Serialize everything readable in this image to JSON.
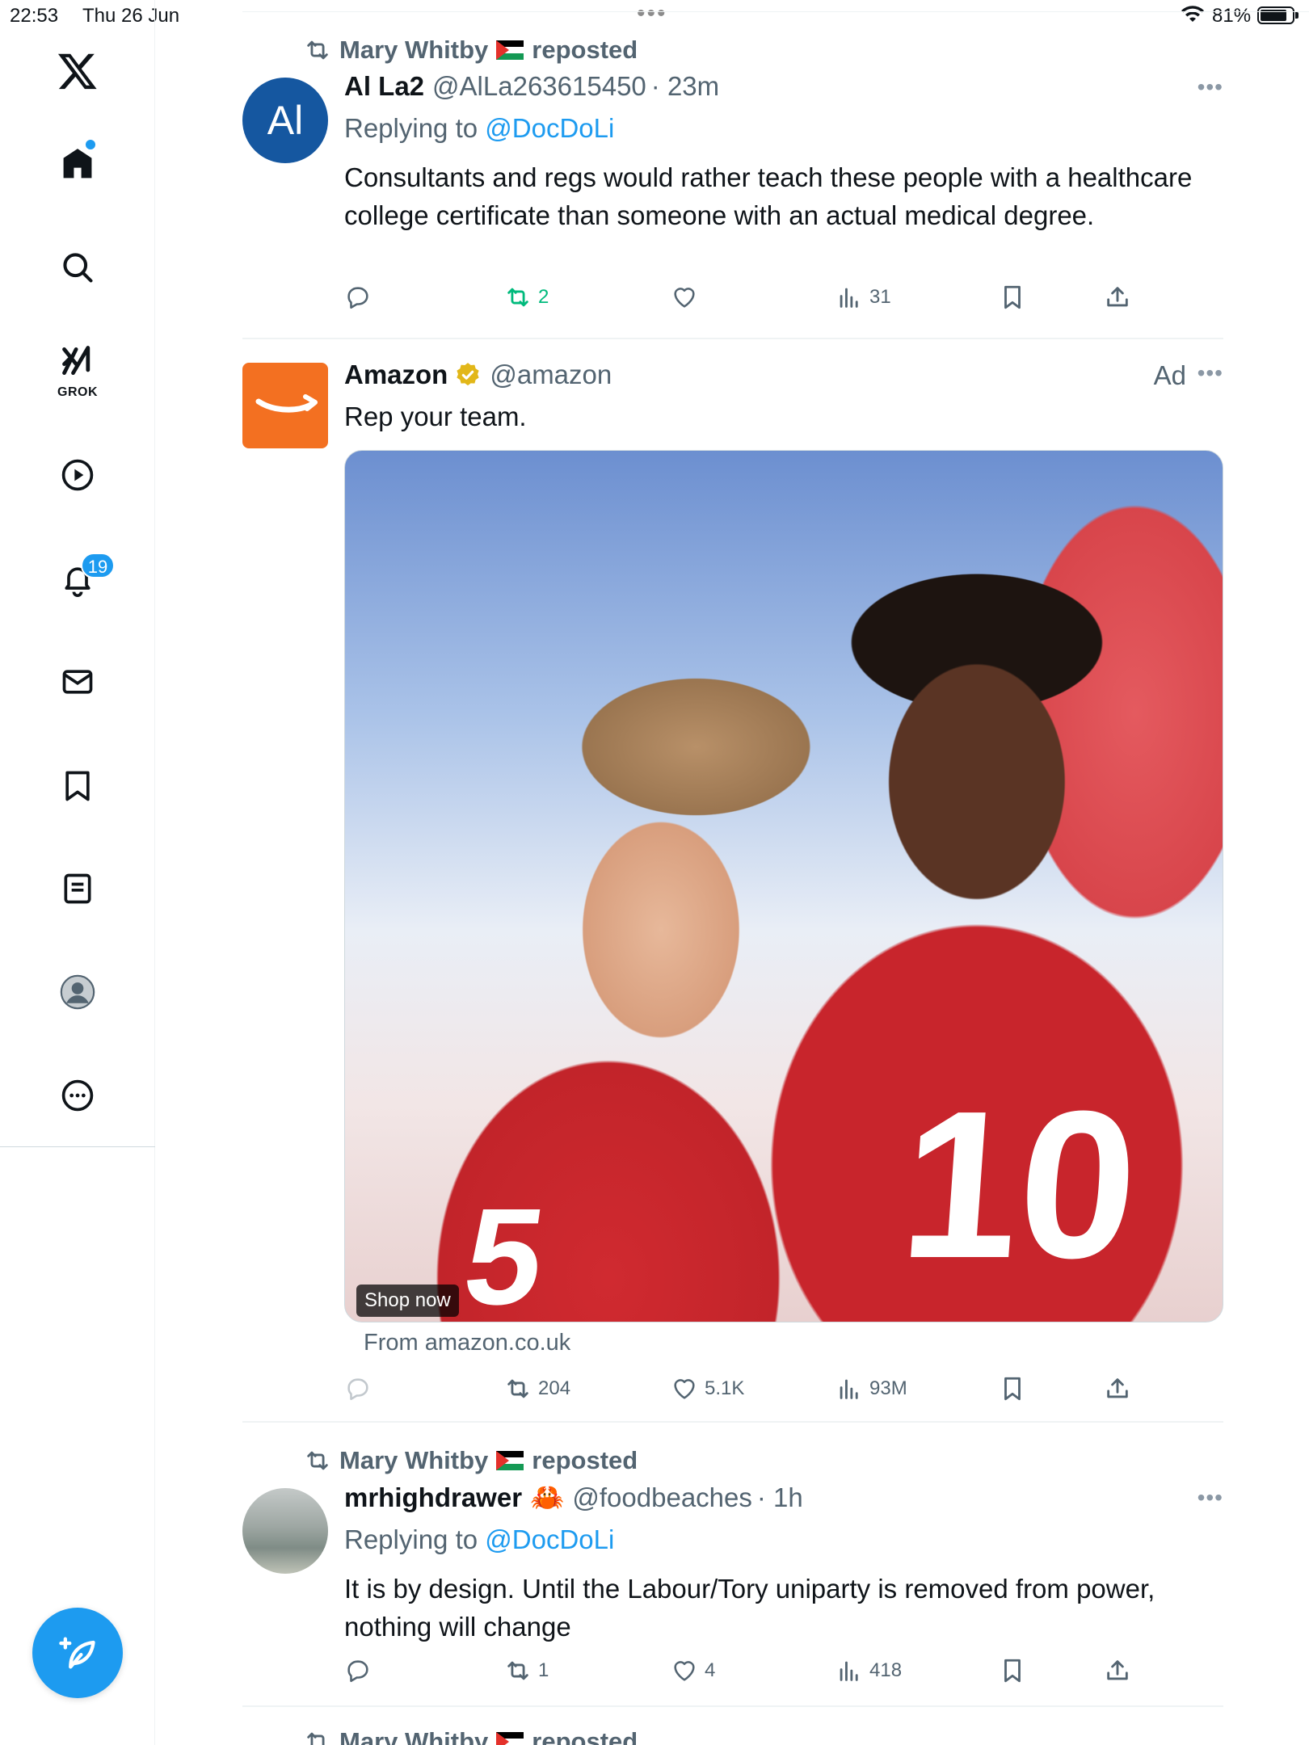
{
  "status_bar": {
    "time": "22:53",
    "date": "Thu 26 Jun",
    "battery": "81%"
  },
  "sidebar": {
    "grok_label": "GROK",
    "notifications_badge": "19",
    "items": [
      "x-logo",
      "home",
      "search",
      "grok",
      "videos",
      "notifications",
      "messages",
      "bookmarks",
      "lists",
      "profile",
      "more"
    ]
  },
  "posts": [
    {
      "reposted_by": "Mary Whitby",
      "repost_suffix": "reposted",
      "avatar_text": "Al",
      "name": "Al La2",
      "handle": "@AlLa263615450",
      "time": "· 23m",
      "replying_to_label": "Replying to",
      "replying_to": "@DocDoLi",
      "text": "Consultants and regs would rather teach these people with a healthcare college certificate than someone with an actual medical degree.",
      "stats": {
        "replies": "",
        "reposts": "2",
        "likes": "",
        "views": "31"
      }
    },
    {
      "name": "Amazon",
      "handle": "@amazon",
      "ad_label": "Ad",
      "text": "Rep your team.",
      "media_cta": "Shop now",
      "media_numbers": [
        "10",
        "5"
      ],
      "from": "From amazon.co.uk",
      "stats": {
        "replies": "",
        "reposts": "204",
        "likes": "5.1K",
        "views": "93M"
      }
    },
    {
      "reposted_by": "Mary Whitby",
      "repost_suffix": "reposted",
      "name": "mrhighdrawer",
      "handle": "@foodbeaches",
      "time": "· 1h",
      "replying_to_label": "Replying to",
      "replying_to": "@DocDoLi",
      "text": "It is by design. Until the Labour/Tory uniparty is removed from power, nothing will change",
      "stats": {
        "replies": "",
        "reposts": "1",
        "likes": "4",
        "views": "418"
      }
    },
    {
      "reposted_by": "Mary Whitby",
      "repost_suffix": "reposted"
    }
  ],
  "colors": {
    "accent": "#1d9bf0",
    "repost_green": "#00ba7c",
    "muted": "#536471"
  }
}
